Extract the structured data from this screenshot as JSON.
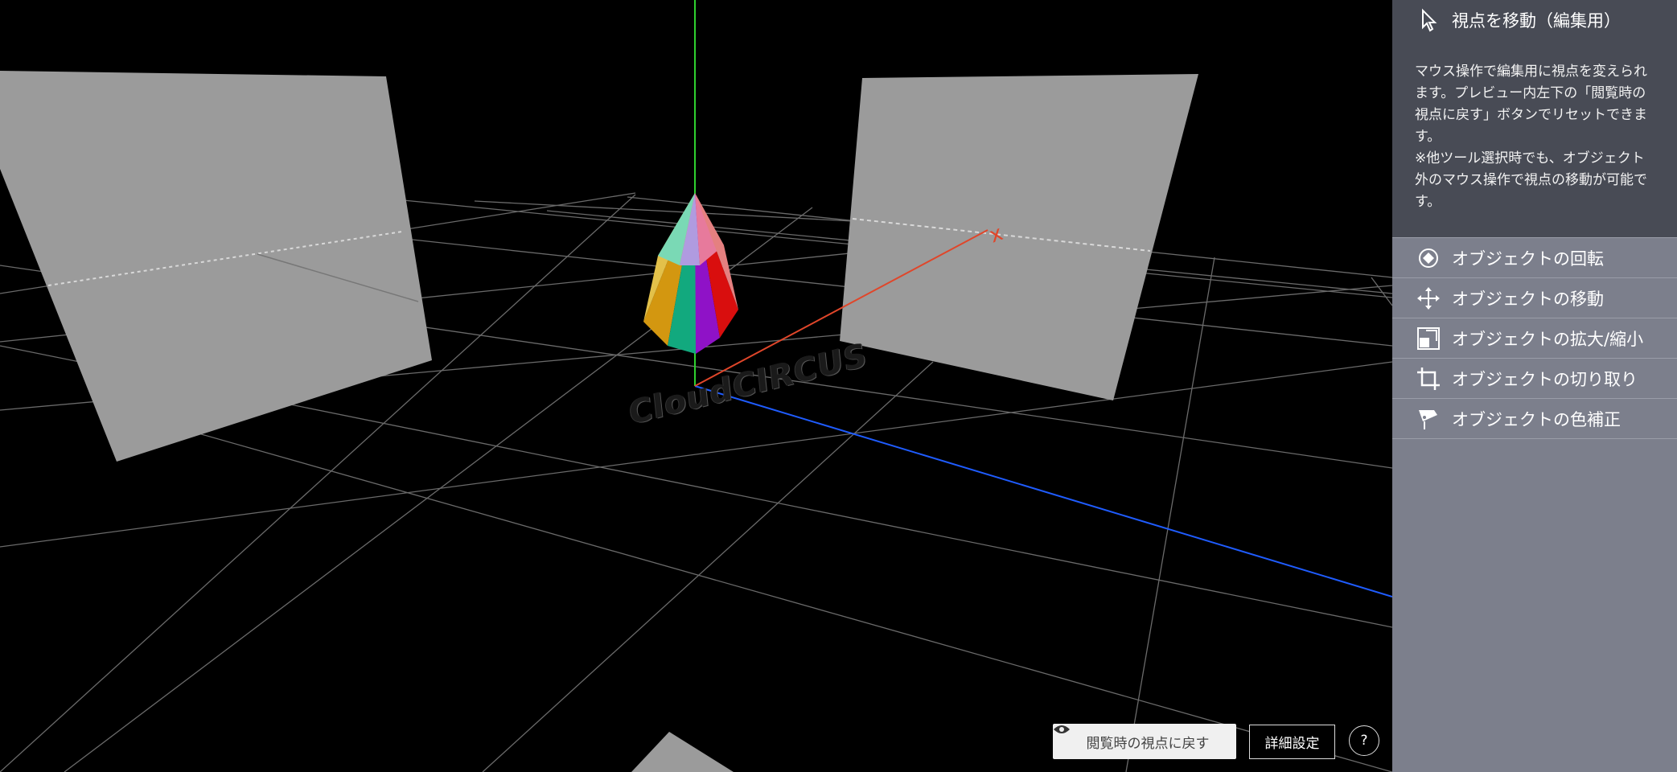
{
  "panel": {
    "active_tool": {
      "label": "視点を移動（編集用）",
      "icon": "cursor-view-icon",
      "description": "マウス操作で編集用に視点を変えられます。プレビュー内左下の「閲覧時の視点に戻す」ボタンでリセットできます。\n※他ツール選択時でも、オブジェクト外のマウス操作で視点の移動が可能です。"
    },
    "tools": [
      {
        "label": "オブジェクトの回転",
        "icon": "rotate-icon"
      },
      {
        "label": "オブジェクトの移動",
        "icon": "move-arrows-icon"
      },
      {
        "label": "オブジェクトの拡大/縮小",
        "icon": "scale-icon"
      },
      {
        "label": "オブジェクトの切り取り",
        "icon": "crop-icon"
      },
      {
        "label": "オブジェクトの色補正",
        "icon": "color-correction-icon"
      }
    ]
  },
  "viewport": {
    "logo_text": "CloudCIRCUS",
    "reset_view_label": "閲覧時の視点に戻す",
    "settings_label": "詳細設定",
    "help_label": "?"
  },
  "colors": {
    "panel_bg": "#7c7f8c",
    "active_bg": "#484b55",
    "axis_x": "#e0462a",
    "axis_y": "#2fd02f",
    "axis_z": "#1f5cff",
    "plane": "#9b9b9b"
  }
}
